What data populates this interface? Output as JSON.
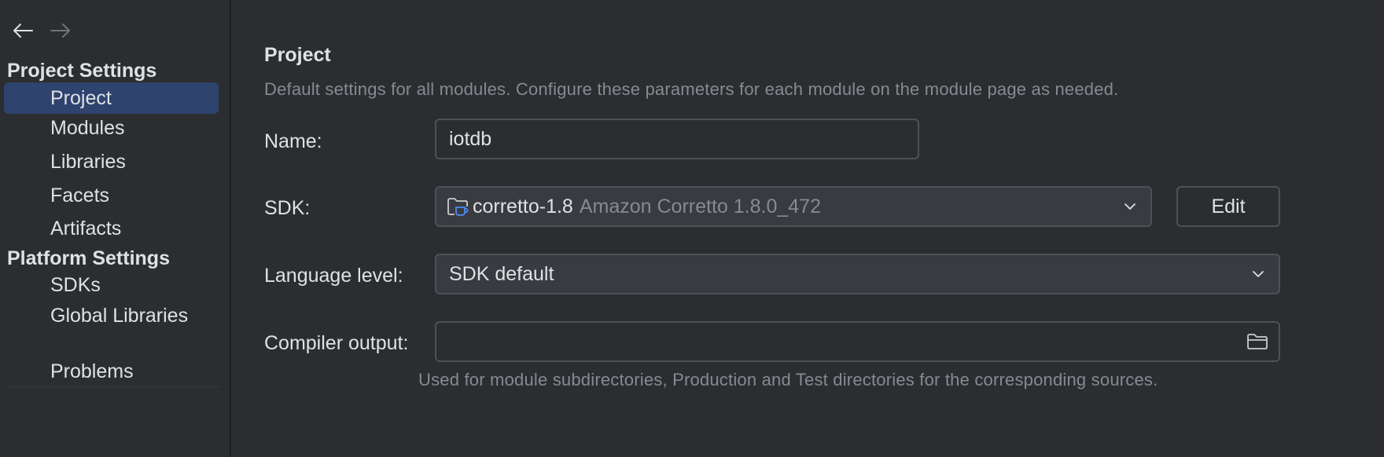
{
  "sidebar": {
    "project_settings_title": "Project Settings",
    "project_items": [
      {
        "label": "Project",
        "selected": true
      },
      {
        "label": "Modules"
      },
      {
        "label": "Libraries"
      },
      {
        "label": "Facets"
      },
      {
        "label": "Artifacts"
      }
    ],
    "platform_settings_title": "Platform Settings",
    "platform_items": [
      {
        "label": "SDKs"
      },
      {
        "label": "Global Libraries"
      }
    ],
    "problems_label": "Problems",
    "icons": {
      "back": "arrow-left-icon",
      "forward": "arrow-right-icon"
    }
  },
  "main": {
    "title": "Project",
    "description": "Default settings for all modules. Configure these parameters for each module on the module page as needed.",
    "name_label": "Name:",
    "name_value": "iotdb",
    "sdk_label": "SDK:",
    "sdk_name": "corretto-1.8",
    "sdk_detail": "Amazon Corretto 1.8.0_472",
    "edit_label": "Edit",
    "language_label": "Language level:",
    "language_value": "SDK default",
    "compiler_label": "Compiler output:",
    "compiler_value": "",
    "compiler_hint": "Used for module subdirectories, Production and Test directories for the corresponding sources."
  },
  "colors": {
    "background": "#2b2d30",
    "selection": "#2e436e",
    "text": "#dfe1e5",
    "muted_text": "#868a91",
    "border": "#4e5157",
    "sdk_icon": "#4a8cf7"
  }
}
